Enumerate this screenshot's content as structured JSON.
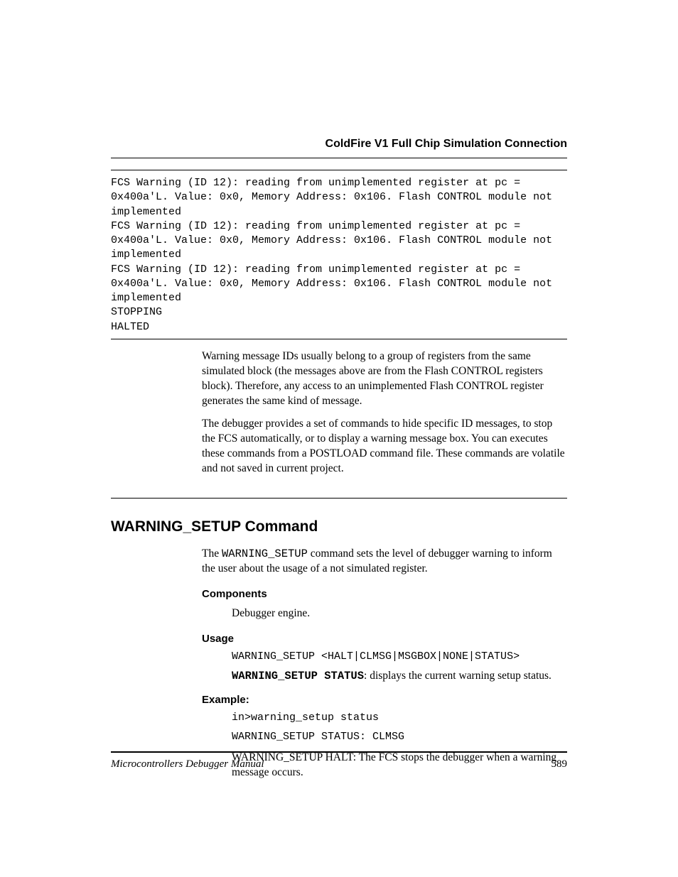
{
  "header": {
    "title": "ColdFire V1 Full Chip Simulation Connection"
  },
  "codeblock": "FCS Warning (ID 12): reading from unimplemented register at pc = 0x400a'L. Value: 0x0, Memory Address: 0x106. Flash CONTROL module not implemented\nFCS Warning (ID 12): reading from unimplemented register at pc = 0x400a'L. Value: 0x0, Memory Address: 0x106. Flash CONTROL module not implemented\nFCS Warning (ID 12): reading from unimplemented register at pc = 0x400a'L. Value: 0x0, Memory Address: 0x106. Flash CONTROL module not implemented\nSTOPPING\nHALTED",
  "paragraphs": {
    "p1": "Warning message IDs usually belong to a group of registers from the same simulated block (the messages above are from the Flash CONTROL registers block). Therefore, any access to an unimplemented Flash CONTROL register generates the same kind of message.",
    "p2": "The debugger provides a set of commands to hide specific ID messages, to stop the FCS automatically, or to display a warning message box. You can executes these commands from a POSTLOAD command file. These commands are volatile and not saved in current project."
  },
  "section": {
    "title": "WARNING_SETUP Command",
    "intro_pre": "The ",
    "intro_code": "WARNING_SETUP",
    "intro_post": " command sets the level of debugger warning to inform the user about the usage of a not simulated register.",
    "components": {
      "heading": "Components",
      "body": "Debugger engine."
    },
    "usage": {
      "heading": "Usage",
      "syntax": "WARNING_SETUP <HALT|CLMSG|MSGBOX|NONE|STATUS>",
      "status_cmd": "WARNING_SETUP STATUS",
      "status_desc": ": displays the current warning setup status."
    },
    "example": {
      "heading": "Example:",
      "line1": "in>warning_setup status",
      "line2": " WARNING_SETUP STATUS: CLMSG",
      "line3": "WARNING_SETUP HALT: The FCS stops the debugger when a warning message occurs."
    }
  },
  "footer": {
    "left": "Microcontrollers Debugger Manual",
    "right": "589"
  }
}
